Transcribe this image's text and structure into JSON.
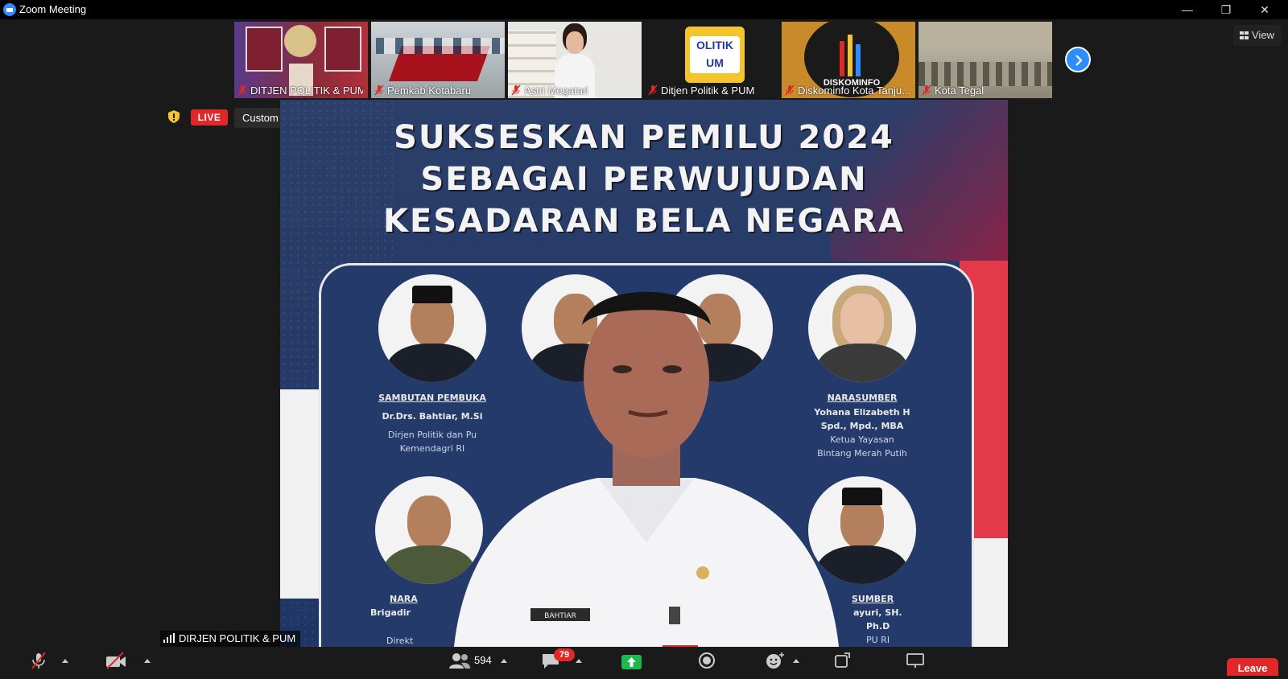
{
  "window": {
    "title": "Zoom Meeting",
    "minimize": "—",
    "maximize": "❐",
    "close": "✕"
  },
  "thumbnails": [
    {
      "name": "DITJEN POLITIK & PUM",
      "muted": true
    },
    {
      "name": "Pemkab Kotabaru",
      "muted": true
    },
    {
      "name": "Astri Megatari",
      "muted": true
    },
    {
      "name": "Ditjen Politik & PUM",
      "muted": true
    },
    {
      "name": "Diskominfo Kota Tanju...",
      "muted": true
    },
    {
      "name": "Kota Tegal",
      "muted": true
    }
  ],
  "thumbnail_logos": {
    "politik_pum": "OLITIK UM",
    "diskominfo": "DISKOMINFO"
  },
  "view_button": "View",
  "live": {
    "badge": "LIVE",
    "service": "Custom Live Streaming Service"
  },
  "slide": {
    "line1": "SUKSESKAN PEMILU 2024",
    "line2": "SEBAGAI PERWUJUDAN",
    "line3": "KESADARAN BELA NEGARA",
    "speakers": [
      {
        "role": "SAMBUTAN PEMBUKA",
        "name": "Dr.Drs. Bahtiar, M.Si",
        "desc1": "Dirjen Politik dan Pu",
        "desc2": "Kemendagri RI"
      },
      {
        "role": "NARASUMBER",
        "name": "Yohana Elizabeth H",
        "name2": "Spd., Mpd., MBA",
        "desc1": "Ketua Yayasan",
        "desc2": "Bintang Merah Putih"
      },
      {
        "role": "NARA",
        "name": "Brigadir",
        "desc1": "Direkt"
      },
      {
        "role": "SUMBER",
        "name": "ayuri, SH.",
        "name2": "Ph.D",
        "desc1": "PU RI"
      }
    ],
    "badge_text": "BAHTIAR"
  },
  "active_speaker": "DIRJEN POLITIK & PUM",
  "toolbar": {
    "participants_count": "594",
    "chat_badge": "79",
    "leave": "Leave"
  },
  "colors": {
    "accent": "#2d8cff",
    "live_red": "#e02828",
    "share_green": "#1db94f",
    "slide_navy": "#233a6b"
  }
}
